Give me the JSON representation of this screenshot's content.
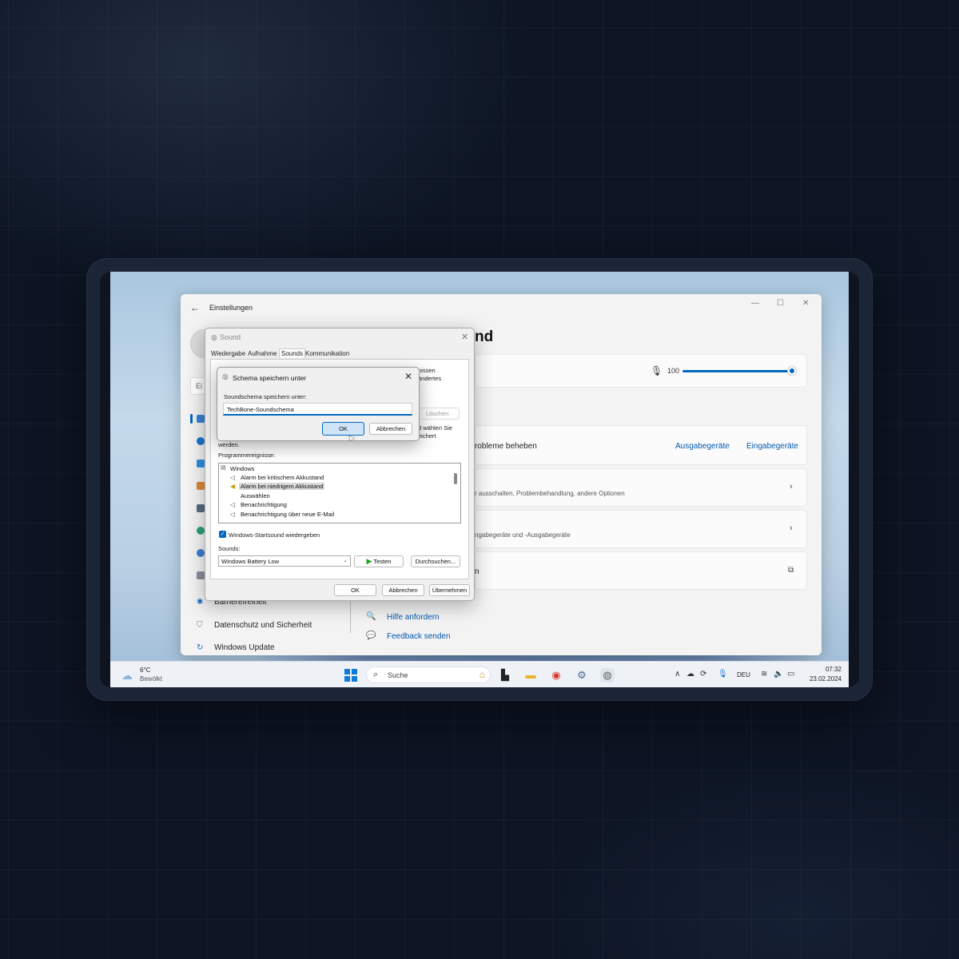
{
  "settings": {
    "title": "Einstellungen",
    "search_partial": "Ei",
    "heading_partial": "nd",
    "nav": {
      "accessibility": "Barrierefreiheit",
      "privacy": "Datenschutz und Sicherheit",
      "update": "Windows Update"
    },
    "volume": {
      "value": "100",
      "level": 1.0
    },
    "rows": {
      "troubleshoot": "robleme beheben",
      "troubleshoot_link_out": "Ausgabegeräte",
      "troubleshoot_link_in": "Eingabegeräte",
      "more_sub": "r ausschalten, Problembehandlung, andere Optionen",
      "devices_sub": "ngabegeräte und -Ausgabegeräte",
      "more_settings_partial": "n"
    },
    "help": "Hilfe anfordern",
    "feedback": "Feedback senden"
  },
  "sound_dialog": {
    "title": "Sound",
    "tabs": [
      "Wiedergabe",
      "Aufnahme",
      "Sounds",
      "Kommunikation"
    ],
    "active_tab": "Sounds",
    "bg_text_1": "nissen",
    "bg_text_2": "ändertes",
    "bg_text_3": "d wählen Sie",
    "bg_text_4": "eichert",
    "bg_text_5": "werden.",
    "delete_button": "Löschen",
    "events_label": "Programmereignisse:",
    "events": [
      "Windows",
      "Alarm bei kritischem Akkustand",
      "Alarm bei niedrigem Akkustand",
      "Auswählen",
      "Benachrichtigung",
      "Benachrichtigung über neue E-Mail"
    ],
    "startup_checkbox": "Windows-Startsound wiedergeben",
    "sounds_label": "Sounds:",
    "sound_value": "Windows Battery Low",
    "test_button": "Testen",
    "browse_button": "Durchsuchen...",
    "ok": "OK",
    "cancel": "Abbrechen",
    "apply": "Übernehmen"
  },
  "save_dialog": {
    "title": "Schema speichern unter",
    "label": "Soundschema speichern unter:",
    "value": "TechBone-Soundschema",
    "ok": "OK",
    "cancel": "Abbrechen"
  },
  "taskbar": {
    "temp": "6°C",
    "condition": "Bewölkt",
    "search": "Suche",
    "lang": "DEU",
    "time": "07:32",
    "date": "23.02.2024"
  }
}
